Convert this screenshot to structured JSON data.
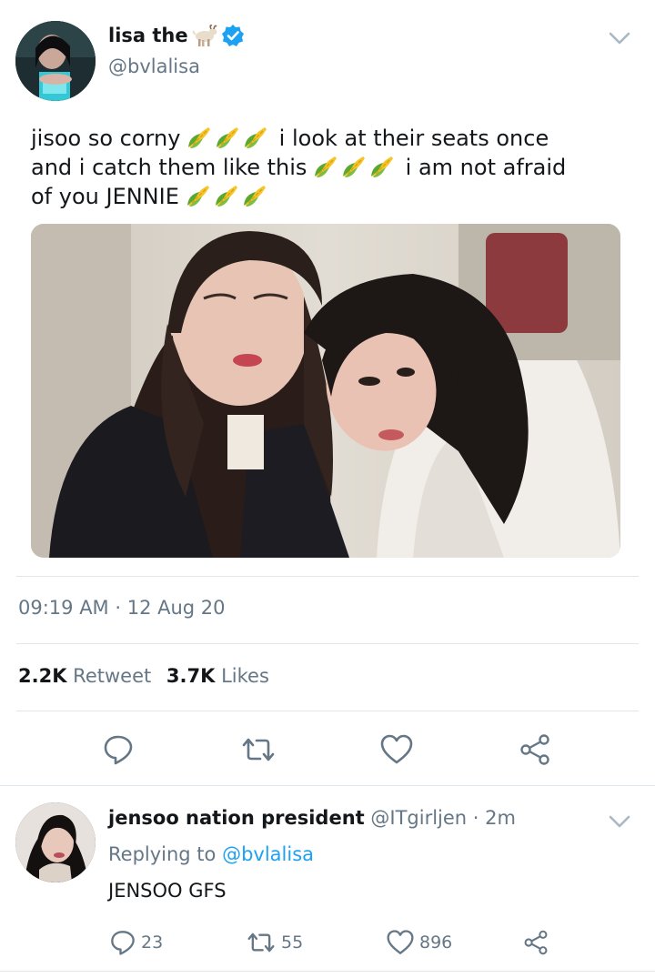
{
  "tweet": {
    "author": {
      "display_name": "lisa the",
      "goat_icon": "goat-emoji-icon",
      "verified_icon": "verified-badge-icon",
      "handle": "@bvlalisa"
    },
    "text": {
      "line1_a": "jisoo so corny",
      "line1_b": "i look at their seats once",
      "line2_a": "and i catch them like this",
      "line2_b": "i am not afraid",
      "line3_a": "of you JENNIE",
      "emoji": "corn-emoji-icon"
    },
    "photo": {
      "description_icon": "photo-two-people-on-plane"
    },
    "timestamp": "09:19 AM · 12 Aug 20",
    "stats": {
      "retweets_count": "2.2K",
      "retweets_label": "Retweet",
      "likes_count": "3.7K",
      "likes_label": "Likes"
    },
    "actions": [
      "reply-icon",
      "retweet-icon",
      "like-icon",
      "share-icon"
    ]
  },
  "reply": {
    "display_name": "jensoo nation president",
    "handle_time": "@ITgirljen · 2m",
    "replying_prefix": "Replying to",
    "replying_to": "@bvlalisa",
    "text": "JENSOO GFS",
    "reply_count": "23",
    "retweet_count": "55",
    "like_count": "896"
  },
  "colors": {
    "text_primary": "#14171a",
    "text_secondary": "#657786",
    "accent": "#1da1f2",
    "divider": "#e1e8ed"
  }
}
